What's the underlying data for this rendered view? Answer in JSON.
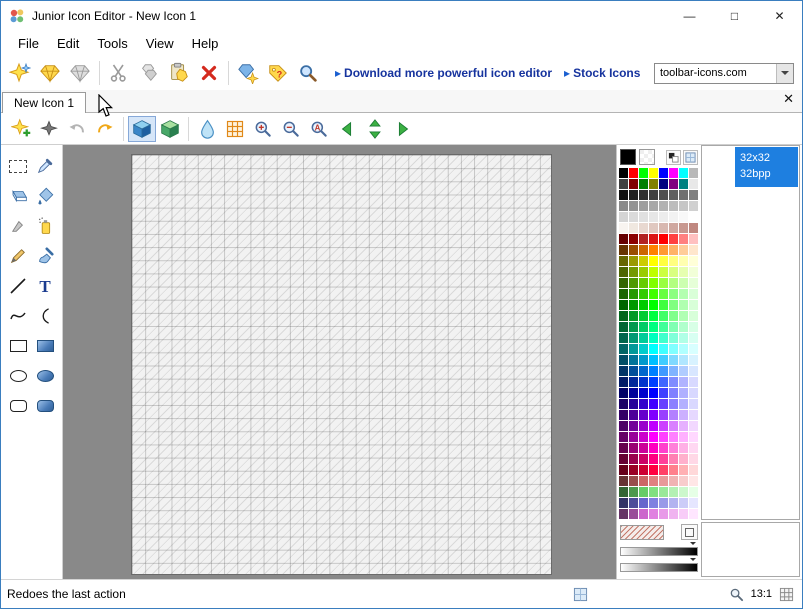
{
  "window": {
    "title": "Junior Icon Editor - New Icon 1",
    "controls": {
      "minimize": "—",
      "maximize": "□",
      "close": "✕"
    }
  },
  "menu": {
    "items": [
      "File",
      "Edit",
      "Tools",
      "View",
      "Help"
    ]
  },
  "toolbar": {
    "link_arrow": "▸",
    "links": [
      {
        "label": "Download more powerful icon editor"
      },
      {
        "label": "Stock Icons"
      }
    ],
    "combo_value": "toolbar-icons.com"
  },
  "tabbar": {
    "active_tab": "New Icon 1",
    "close_glyph": "✕"
  },
  "glyphs": {
    "text_tool": "T",
    "zoom_actual": "A",
    "help_mark": "?"
  },
  "format_list": {
    "selected": {
      "size": "32x32",
      "depth": "32bpp"
    }
  },
  "statusbar": {
    "message": "Redoes the last action",
    "zoom_ratio": "13:1"
  },
  "canvas": {
    "grid_cells": 32
  },
  "ui_colors": {
    "selection_blue": "#1E7FE0",
    "link_navy": "#16339E",
    "workspace_gray": "#898989",
    "foreground": "#000000",
    "background": "#FFFFFF"
  },
  "palette": {
    "foreground": "#000000",
    "background": "#FFFFFF",
    "rows": [
      [
        "#000000",
        "#FF0000",
        "#00FF00",
        "#FFFF00",
        "#0000FF",
        "#FF00FF",
        "#00FFFF",
        "#B8B8B8"
      ],
      [
        "#404040",
        "#800000",
        "#008000",
        "#808000",
        "#000080",
        "#800080",
        "#008080",
        "#E8E8E8"
      ],
      [
        "#101010",
        "#202020",
        "#303030",
        "#404040",
        "#505050",
        "#606060",
        "#707070",
        "#808080"
      ],
      [
        "#8A8A8A",
        "#949494",
        "#9E9E9E",
        "#A8A8A8",
        "#B2B2B2",
        "#BCBCBC",
        "#C6C6C6",
        "#D0D0D0"
      ],
      [
        "#D4D4D4",
        "#DADADA",
        "#E0E0E0",
        "#E6E6E6",
        "#ECECEC",
        "#F2F2F2",
        "#F8F8F8",
        "#FFFFFF"
      ],
      [
        "#F8F4F0",
        "#F0E8E0",
        "#E8D8D0",
        "#E0C8C0",
        "#D8B8B0",
        "#D0A8A0",
        "#C89890",
        "#C08880"
      ],
      [
        "#660000",
        "#8B0000",
        "#B22222",
        "#DC1414",
        "#FF0000",
        "#FF4040",
        "#FF8080",
        "#FFC0C0"
      ],
      [
        "#663300",
        "#994D00",
        "#CC6600",
        "#FF8000",
        "#FF9933",
        "#FFB366",
        "#FFCC99",
        "#FFE6CC"
      ],
      [
        "#666600",
        "#999900",
        "#CCCC00",
        "#FFFF00",
        "#FFFF40",
        "#FFFF80",
        "#FFFFB0",
        "#FFFFD8"
      ],
      [
        "#4D6600",
        "#739900",
        "#99CC00",
        "#BFFF00",
        "#CCFF40",
        "#D9FF80",
        "#E6FFB0",
        "#F2FFD8"
      ],
      [
        "#336600",
        "#4D9900",
        "#66CC00",
        "#80FF00",
        "#99FF40",
        "#B3FF80",
        "#CCFFB0",
        "#E6FFD8"
      ],
      [
        "#1A6600",
        "#269900",
        "#33CC00",
        "#40FF00",
        "#66FF40",
        "#8CFF80",
        "#B3FFB0",
        "#D9FFD8"
      ],
      [
        "#006600",
        "#009900",
        "#00CC00",
        "#00FF00",
        "#40FF40",
        "#80FF80",
        "#B0FFB0",
        "#D8FFD8"
      ],
      [
        "#00661A",
        "#009926",
        "#00CC33",
        "#00FF40",
        "#40FF66",
        "#80FF8C",
        "#B0FFB3",
        "#D8FFD9"
      ],
      [
        "#006633",
        "#00994D",
        "#00CC66",
        "#00FF80",
        "#40FF99",
        "#80FFB3",
        "#B0FFCC",
        "#D8FFE6"
      ],
      [
        "#00664D",
        "#009973",
        "#00CC99",
        "#00FFBF",
        "#40FFCC",
        "#80FFD9",
        "#B0FFE6",
        "#D8FFF2"
      ],
      [
        "#006666",
        "#009999",
        "#00CCCC",
        "#00FFFF",
        "#40FFFF",
        "#80FFFF",
        "#B0FFFF",
        "#D8FFFF"
      ],
      [
        "#004D66",
        "#007399",
        "#0099CC",
        "#00BFFF",
        "#40CCFF",
        "#80D9FF",
        "#B0E6FF",
        "#D8F2FF"
      ],
      [
        "#003366",
        "#004D99",
        "#0066CC",
        "#0080FF",
        "#4099FF",
        "#80B3FF",
        "#B0CCFF",
        "#D8E6FF"
      ],
      [
        "#001A66",
        "#002699",
        "#0033CC",
        "#0040FF",
        "#4066FF",
        "#808CFF",
        "#B0B3FF",
        "#D8D9FF"
      ],
      [
        "#000066",
        "#000099",
        "#0000CC",
        "#0000FF",
        "#4040FF",
        "#8080FF",
        "#B0B0FF",
        "#D8D8FF"
      ],
      [
        "#1A0066",
        "#260099",
        "#3300CC",
        "#4000FF",
        "#6640FF",
        "#8C80FF",
        "#B3B0FF",
        "#D9D8FF"
      ],
      [
        "#330066",
        "#4D0099",
        "#6600CC",
        "#8000FF",
        "#9940FF",
        "#B380FF",
        "#CCB0FF",
        "#E6D8FF"
      ],
      [
        "#4D0066",
        "#730099",
        "#9900CC",
        "#BF00FF",
        "#CC40FF",
        "#D980FF",
        "#E6B0FF",
        "#F2D8FF"
      ],
      [
        "#660066",
        "#990099",
        "#CC00CC",
        "#FF00FF",
        "#FF40FF",
        "#FF80FF",
        "#FFB0FF",
        "#FFD8FF"
      ],
      [
        "#66004D",
        "#990073",
        "#CC0099",
        "#FF00BF",
        "#FF40CC",
        "#FF80D9",
        "#FFB0E6",
        "#FFD8F2"
      ],
      [
        "#660033",
        "#99004D",
        "#CC0066",
        "#FF0080",
        "#FF4099",
        "#FF80B3",
        "#FFB0CC",
        "#FFD8E6"
      ],
      [
        "#66001A",
        "#990026",
        "#CC0033",
        "#FF0040",
        "#FF4066",
        "#FF808C",
        "#FFB0B3",
        "#FFD8D9"
      ],
      [
        "#663333",
        "#994D4D",
        "#CC6666",
        "#E08080",
        "#E89999",
        "#F0B3B3",
        "#F8CCCC",
        "#FFE6E6"
      ],
      [
        "#336633",
        "#4D994D",
        "#66CC66",
        "#80E080",
        "#99E899",
        "#B3F0B3",
        "#CCF8CC",
        "#E6FFE6"
      ],
      [
        "#333366",
        "#4D4D99",
        "#6666CC",
        "#8080E0",
        "#9999E8",
        "#B3B3F0",
        "#CCCCF8",
        "#E6E6FF"
      ],
      [
        "#663366",
        "#994D99",
        "#CC66CC",
        "#E080E0",
        "#E899E8",
        "#F0B3F0",
        "#F8CCF8",
        "#FFE6FF"
      ]
    ]
  }
}
